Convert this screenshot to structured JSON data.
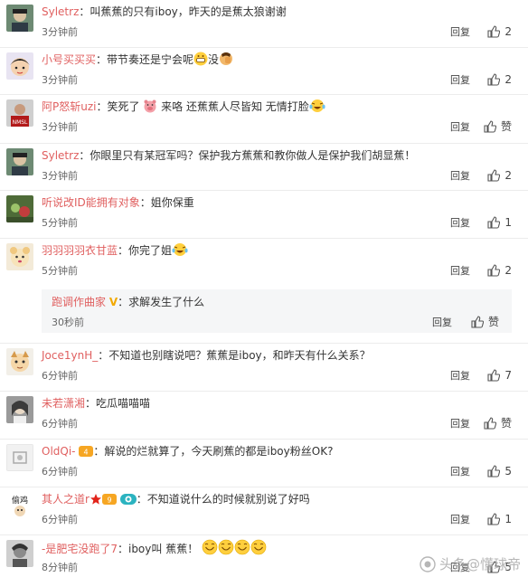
{
  "comments": [
    {
      "user": "Syletrz",
      "colon": "：",
      "text": "叫蕉蕉的只有iboy，昨天的是蕉太狼谢谢",
      "time": "3分钟前",
      "reply": "回复",
      "likes": "2"
    },
    {
      "user": "小号买买买",
      "colon": "：",
      "text": "带节奏还是宁会呢",
      "text2": "没",
      "time": "3分钟前",
      "reply": "回复",
      "likes": "2"
    },
    {
      "user": "阿P怒斩uzi",
      "colon": "：",
      "text": "笑死了",
      "text2": "来咯 还蕉蕉人尽皆知 无情打脸",
      "time": "3分钟前",
      "reply": "回复",
      "likes": "赞"
    },
    {
      "user": "Syletrz",
      "colon": "：",
      "text": "你眼里只有某冠军吗？保护我方蕉蕉和教你做人是保护我们胡显蕉！",
      "time": "3分钟前",
      "reply": "回复",
      "likes": "2"
    },
    {
      "user": "听说改ID能拥有对象",
      "colon": "：",
      "text": "姐你保重",
      "time": "5分钟前",
      "reply": "回复",
      "likes": "1"
    },
    {
      "user": "羽羽羽羽衣甘蓝",
      "colon": "：",
      "text": "你完了姐",
      "time": "5分钟前",
      "reply": "回复",
      "likes": "2"
    },
    {
      "user": "跑调作曲家",
      "colon": "：",
      "text": "求解发生了什么",
      "time": "30秒前",
      "reply": "回复",
      "likes": "赞"
    },
    {
      "user": "Joce1ynH_",
      "colon": "：",
      "text": "不知道也别瞎说吧？蕉蕉是iboy，和昨天有什么关系？",
      "time": "6分钟前",
      "reply": "回复",
      "likes": "7"
    },
    {
      "user": "未若潇湘",
      "colon": "：",
      "text": "吃瓜喵喵喵",
      "time": "6分钟前",
      "reply": "回复",
      "likes": "赞"
    },
    {
      "user": "OldQi-",
      "colon": "：",
      "text": "解说的烂就算了，今天刷蕉的都是iboy粉丝OK?",
      "time": "6分钟前",
      "reply": "回复",
      "likes": "5"
    },
    {
      "user": "其人之道r",
      "colon": "：",
      "text": "不知道说什么的时候就别说了好吗",
      "time": "6分钟前",
      "reply": "回复",
      "likes": "1"
    },
    {
      "user": "-是肥宅没跑了7",
      "colon": "：",
      "text": "iboy叫 蕉蕉！",
      "time": "8分钟前",
      "reply": "回复",
      "likes": "5"
    }
  ],
  "watermark": "头条@懂球帝",
  "icons": {
    "like": "thumb-up-icon",
    "emoji": "emoji-icon"
  },
  "colors": {
    "username": "#e06060",
    "vbadge": "#f2a900"
  }
}
